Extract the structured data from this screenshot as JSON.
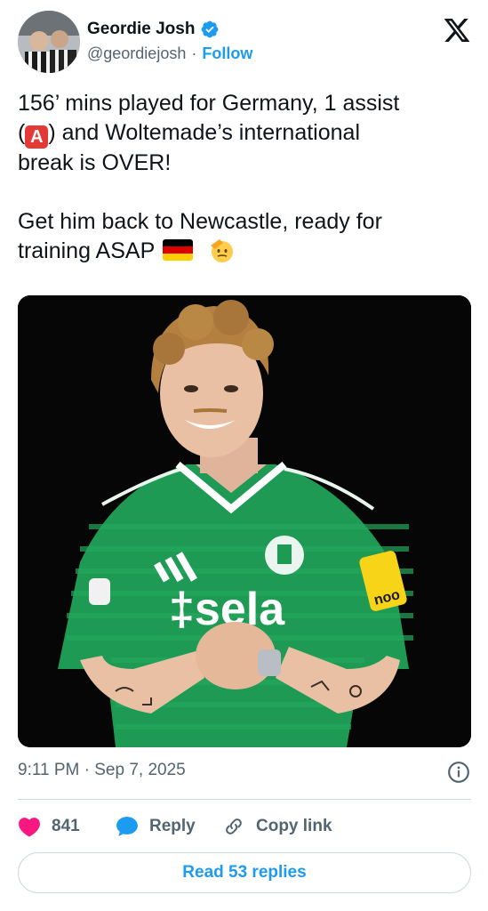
{
  "author": {
    "name": "Geordie Josh",
    "handle": "@geordiejosh",
    "separator": "·",
    "follow_label": "Follow",
    "verified": true,
    "verified_color": "#1d9bf0"
  },
  "platform_icon": "x-logo-icon",
  "tweet": {
    "line1_a": "156’ mins played for Germany, 1 assist",
    "line2_open": "(",
    "line2_emoji": "A",
    "line2_rest": ") and Woltemade’s international",
    "line3": "break is OVER!",
    "line4": "Get him back to Newcastle, ready for",
    "line5": "training ASAP"
  },
  "media": {
    "description_icon": "player-photo",
    "shirt_color": "#1f9a54"
  },
  "meta": {
    "timestamp": "9:11 PM · Sep 7, 2025"
  },
  "actions": {
    "like_count": "841",
    "reply_label": "Reply",
    "copy_label": "Copy link"
  },
  "read_replies_label": "Read 53 replies",
  "colors": {
    "accent": "#1d9bf0",
    "like": "#f91880",
    "text": "#0f1419",
    "muted": "#536471",
    "border": "#cfd9de"
  }
}
